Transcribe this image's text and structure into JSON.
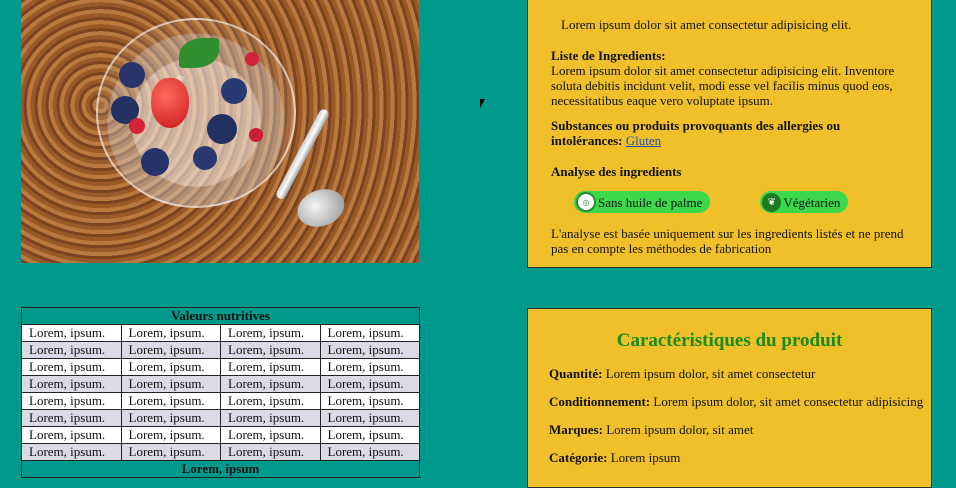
{
  "ingredients_panel": {
    "intro": "Lorem ipsum dolor sit amet consectetur adipisicing elit.",
    "list_heading": "Liste de Ingredients:",
    "list_text": "Lorem ipsum dolor sit amet consectetur adipisicing elit. Inventore soluta debitis incidunt velit, modi esse vel facilis minus quod eos, necessitatibus eaque vero voluptate ipsum.",
    "allergens_heading": "Substances ou produits provoquants des allergies ou intolérances:",
    "allergens_link": "Gluten",
    "analysis_heading": "Analyse des ingredients",
    "badges": [
      {
        "label": "Sans huile de palme",
        "icon": "palm-oil-free-icon"
      },
      {
        "label": "Végétarien",
        "icon": "leaf-icon"
      }
    ],
    "analysis_note": "L'analyse est basée uniquement sur les ingredients listés et ne prend pas en compte les méthodes de fabrication"
  },
  "nutrition_table": {
    "title": "Valeurs nutritives",
    "rows": [
      [
        "Lorem, ipsum.",
        "Lorem, ipsum.",
        "Lorem, ipsum.",
        "Lorem, ipsum."
      ],
      [
        "Lorem, ipsum.",
        "Lorem, ipsum.",
        "Lorem, ipsum.",
        "Lorem, ipsum."
      ],
      [
        "Lorem, ipsum.",
        "Lorem, ipsum.",
        "Lorem, ipsum.",
        "Lorem, ipsum."
      ],
      [
        "Lorem, ipsum.",
        "Lorem, ipsum.",
        "Lorem, ipsum.",
        "Lorem, ipsum."
      ],
      [
        "Lorem, ipsum.",
        "Lorem, ipsum.",
        "Lorem, ipsum.",
        "Lorem, ipsum."
      ],
      [
        "Lorem, ipsum.",
        "Lorem, ipsum.",
        "Lorem, ipsum.",
        "Lorem, ipsum."
      ],
      [
        "Lorem, ipsum.",
        "Lorem, ipsum.",
        "Lorem, ipsum.",
        "Lorem, ipsum."
      ],
      [
        "Lorem, ipsum.",
        "Lorem, ipsum.",
        "Lorem, ipsum.",
        "Lorem, ipsum."
      ]
    ],
    "footer": "Lorem, ipsum"
  },
  "characteristics_panel": {
    "title": "Caractéristiques du produit",
    "items": [
      {
        "label": "Quantité:",
        "value": "Lorem ipsum dolor, sit amet consectetur"
      },
      {
        "label": "Conditionnement:",
        "value": "Lorem ipsum dolor, sit amet consectetur adipisicing"
      },
      {
        "label": "Marques:",
        "value": "Lorem ipsum dolor, sit amet"
      },
      {
        "label": "Catégorie:",
        "value": "Lorem ipsum"
      }
    ]
  },
  "colors": {
    "page_background": "#009a8c",
    "panel_background": "#f0c02b",
    "badge_background": "#3ad84a",
    "title_green": "#1a8a1a",
    "row_alt": "#dadbe4"
  }
}
